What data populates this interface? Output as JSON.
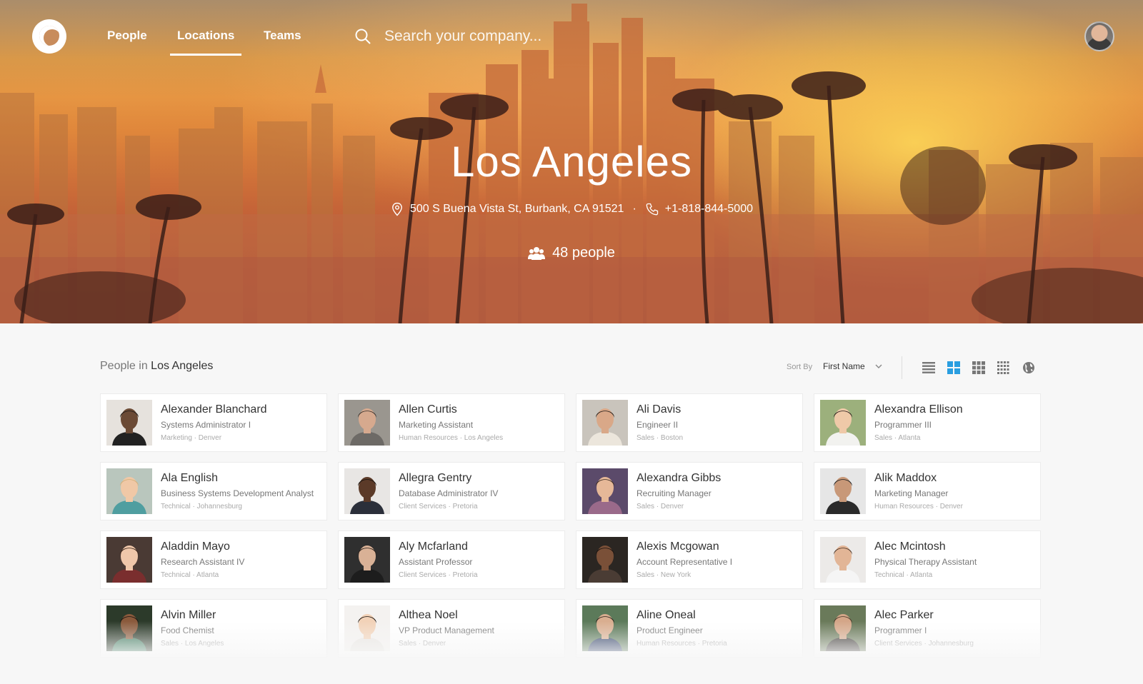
{
  "nav": {
    "links": [
      "People",
      "Locations",
      "Teams"
    ],
    "active": "Locations",
    "search_placeholder": "Search your company..."
  },
  "hero": {
    "title": "Los Angeles",
    "address": "500 S Buena Vista St, Burbank, CA 91521",
    "separator": "·",
    "phone": "+1-818-844-5000",
    "people_count": "48 people"
  },
  "toolbar": {
    "heading_prefix": "People in",
    "heading_location": "Los Angeles",
    "sort_label": "Sort By",
    "sort_value": "First Name",
    "views": [
      "list-view-icon",
      "large-grid-view-icon",
      "grid-view-icon",
      "dense-grid-view-icon",
      "globe-view-icon"
    ],
    "active_view": "large-grid-view-icon"
  },
  "people": [
    {
      "name": "Alexander Blanchard",
      "role": "Systems Administrator I",
      "dept": "Marketing · Denver",
      "skin": "#6b4a35",
      "hair": "#1f1a18",
      "bg": "#e6e2dd",
      "shirt": "#222"
    },
    {
      "name": "Allen Curtis",
      "role": "Marketing Assistant",
      "dept": "Human Resources · Los Angeles",
      "skin": "#d6a98e",
      "hair": "#3c342e",
      "bg": "#9a968f",
      "shirt": "#6d6a66"
    },
    {
      "name": "Ali Davis",
      "role": "Engineer II",
      "dept": "Sales · Boston",
      "skin": "#d9a888",
      "hair": "#2a221d",
      "bg": "#c9c4bc",
      "shirt": "#ece6dc"
    },
    {
      "name": "Alexandra Ellison",
      "role": "Programmer III",
      "dept": "Sales · Atlanta",
      "skin": "#efc9a8",
      "hair": "#2b221e",
      "bg": "#9cb07c",
      "shirt": "#f2f2ef"
    },
    {
      "name": "Ala English",
      "role": "Business Systems Development Analyst",
      "dept": "Technical · Johannesburg",
      "skin": "#f0c8a6",
      "hair": "#d3b07a",
      "bg": "#b9c6bd",
      "shirt": "#4f9ea0"
    },
    {
      "name": "Allegra Gentry",
      "role": "Database Administrator IV",
      "dept": "Client Services · Pretoria",
      "skin": "#5b3a28",
      "hair": "#1a1410",
      "bg": "#e8e6e4",
      "shirt": "#2b2f3a"
    },
    {
      "name": "Alexandra Gibbs",
      "role": "Recruiting Manager",
      "dept": "Sales · Denver",
      "skin": "#e6b898",
      "hair": "#3d2c22",
      "bg": "#5b4a6a",
      "shirt": "#9a6a8a"
    },
    {
      "name": "Alik Maddox",
      "role": "Marketing Manager",
      "dept": "Human Resources · Denver",
      "skin": "#c89878",
      "hair": "#222",
      "bg": "#e6e6e6",
      "shirt": "#2a2a2a"
    },
    {
      "name": "Aladdin Mayo",
      "role": "Research Assistant IV",
      "dept": "Technical · Atlanta",
      "skin": "#efc7aa",
      "hair": "#3a2418",
      "bg": "#4a3a34",
      "shirt": "#7a2e2e"
    },
    {
      "name": "Aly Mcfarland",
      "role": "Assistant Professor",
      "dept": "Client Services · Pretoria",
      "skin": "#d9b196",
      "hair": "#2a201a",
      "bg": "#2f2f2f",
      "shirt": "#1d1d1d"
    },
    {
      "name": "Alexis Mcgowan",
      "role": "Account Representative I",
      "dept": "Sales · New York",
      "skin": "#7a5038",
      "hair": "#1c1410",
      "bg": "#2b2622",
      "shirt": "#4a3c34"
    },
    {
      "name": "Alec Mcintosh",
      "role": "Physical Therapy Assistant",
      "dept": "Technical · Atlanta",
      "skin": "#e2b596",
      "hair": "#4a3426",
      "bg": "#eceae8",
      "shirt": "#f5f5f5"
    },
    {
      "name": "Alvin Miller",
      "role": "Food Chemist",
      "dept": "Sales · Los Angeles",
      "skin": "#8a5a3c",
      "hair": "#1c1612",
      "bg": "#2c3a2a",
      "shirt": "#3e7a5e"
    },
    {
      "name": "Althea Noel",
      "role": "VP Product Management",
      "dept": "Sales · Denver",
      "skin": "#f2d2b8",
      "hair": "#1f1814",
      "bg": "#f4f2f0",
      "shirt": "#e9e6e2"
    },
    {
      "name": "Aline Oneal",
      "role": "Product Engineer",
      "dept": "Human Resources · Pretoria",
      "skin": "#d9ae90",
      "hair": "#2c241e",
      "bg": "#5c7a5a",
      "shirt": "#2f3f66"
    },
    {
      "name": "Alec Parker",
      "role": "Programmer I",
      "dept": "Client Services · Johannesburg",
      "skin": "#d4a688",
      "hair": "#4a3a2a",
      "bg": "#6a7a5a",
      "shirt": "#3a3632"
    }
  ]
}
